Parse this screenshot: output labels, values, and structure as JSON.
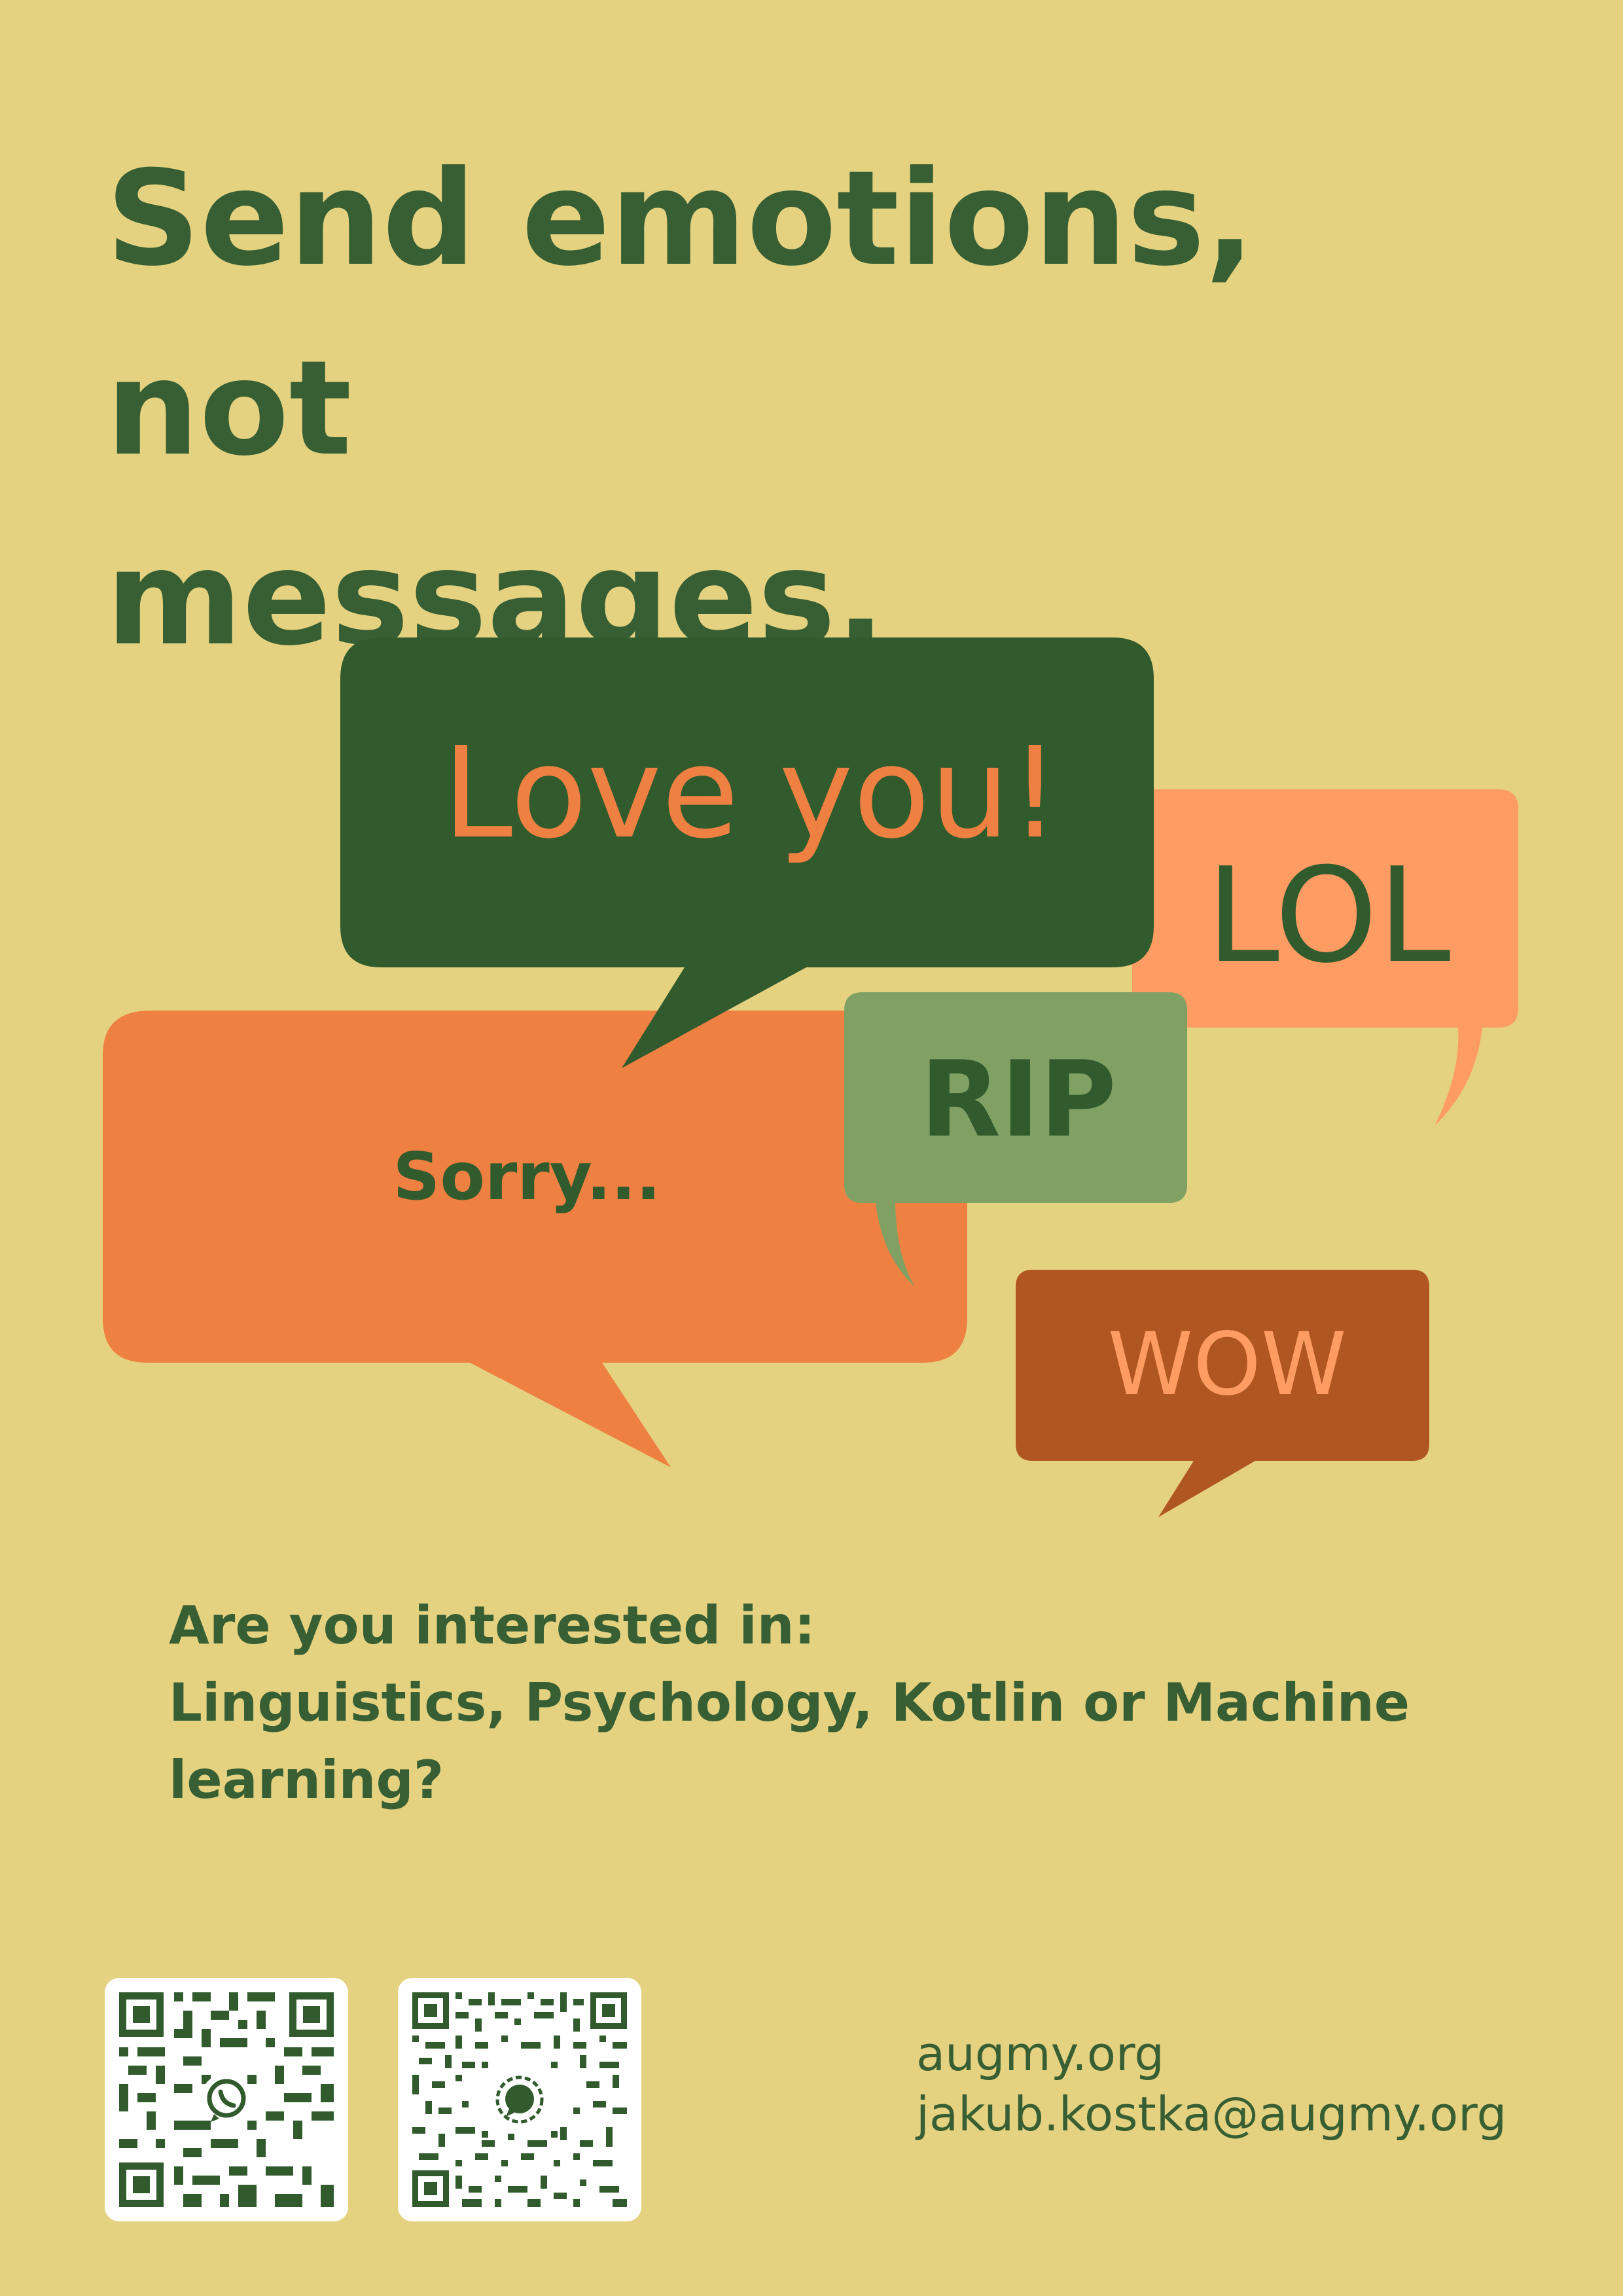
{
  "headline": {
    "line1": "Send emotions, not",
    "line2": "messages."
  },
  "bubbles": {
    "love": "Love you!",
    "lol": "LOL",
    "rip": "RIP",
    "sorry": "Sorry...",
    "wow": "WOW"
  },
  "question": {
    "line1": "Are you interested in:",
    "line2": "Linguistics, Psychology, Kotlin or Machine",
    "line3": "learning?"
  },
  "qr_codes": [
    {
      "icon": "whatsapp-icon"
    },
    {
      "icon": "signal-icon"
    }
  ],
  "contact": {
    "website": "augmy.org",
    "email": "jakub.kostka@augmy.org"
  },
  "colors": {
    "background": "#e5d281",
    "dark_green": "#315a2d",
    "text_green": "#375f33",
    "orange": "#ee8041",
    "light_orange": "#fe9c63",
    "sage_green": "#80a163",
    "rust": "#b05620"
  }
}
